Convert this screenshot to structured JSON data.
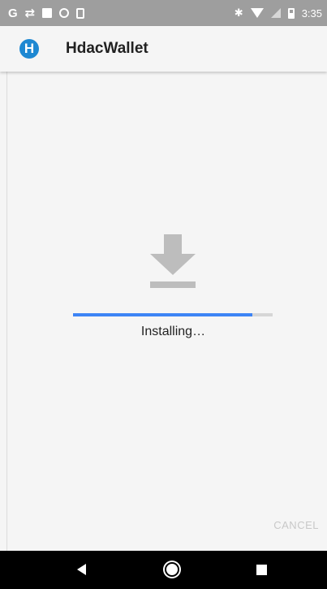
{
  "status_bar": {
    "time": "3:35",
    "left_icons": [
      "google-icon",
      "transfer-icon",
      "image-icon",
      "circle-icon",
      "phone-icon"
    ],
    "right_icons": [
      "bluetooth-icon",
      "wifi-icon",
      "signal-icon",
      "battery-icon"
    ]
  },
  "app_bar": {
    "logo_glyph": "H",
    "title": "HdacWallet"
  },
  "installer": {
    "icon": "download-icon",
    "progress": 0.9,
    "status": "Installing…",
    "cancel_label": "CANCEL"
  },
  "nav_bar": {
    "icons": [
      "back-icon",
      "home-icon",
      "recents-icon"
    ]
  },
  "colors": {
    "accent": "#3d84f5",
    "logo": "#1e88d2",
    "status_bar": "#9e9e9e"
  }
}
